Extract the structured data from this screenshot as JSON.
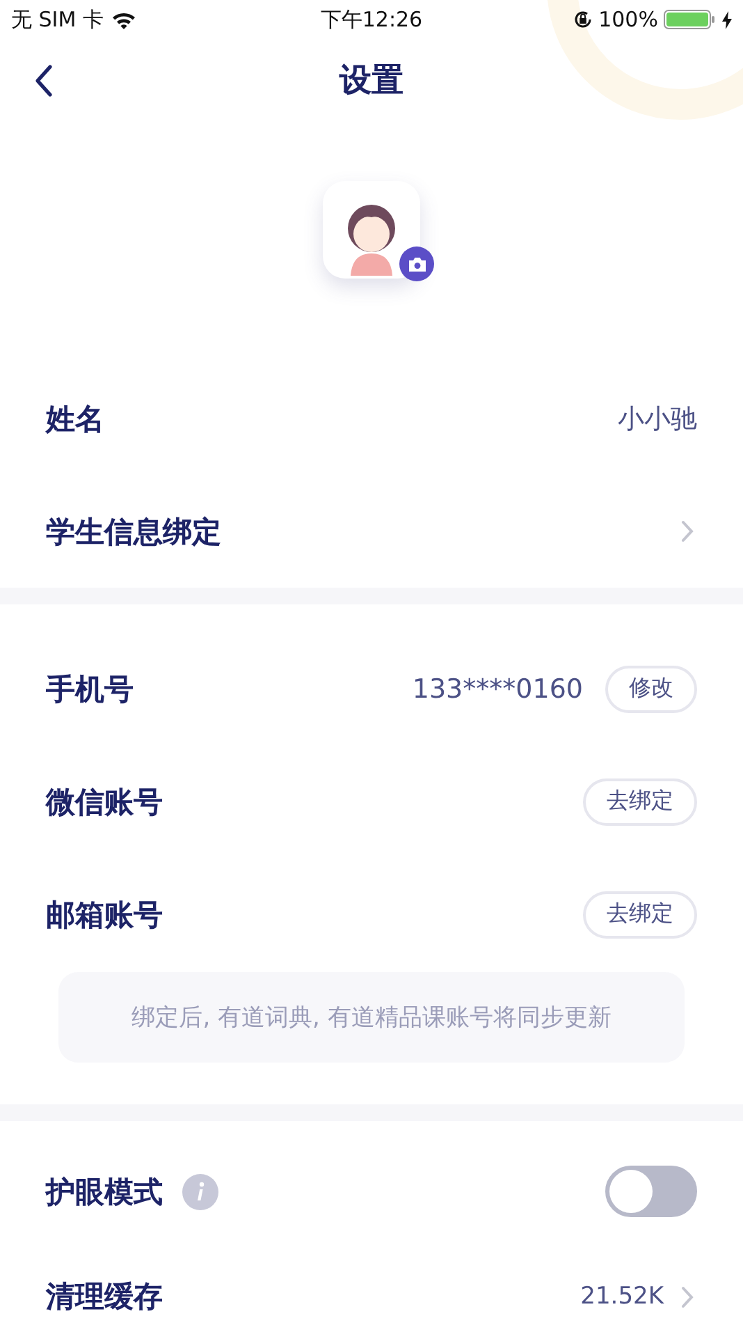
{
  "status_bar": {
    "carrier": "无 SIM 卡",
    "time": "下午12:26",
    "battery": "100%"
  },
  "nav": {
    "title": "设置"
  },
  "sections": [
    {
      "items": [
        {
          "kind": "value",
          "label": "姓名",
          "value": "小小驰"
        },
        {
          "kind": "link",
          "label": "学生信息绑定"
        }
      ]
    },
    {
      "items": [
        {
          "kind": "action",
          "label": "手机号",
          "value": "133****0160",
          "button": "修改"
        },
        {
          "kind": "action",
          "label": "微信账号",
          "button": "去绑定"
        },
        {
          "kind": "action",
          "label": "邮箱账号",
          "button": "去绑定"
        }
      ],
      "note": "绑定后, 有道词典, 有道精品课账号将同步更新"
    },
    {
      "items": [
        {
          "kind": "toggle",
          "label": "护眼模式",
          "info": true,
          "on": false
        },
        {
          "kind": "link",
          "label": "清理缓存",
          "value": "21.52K"
        }
      ]
    }
  ]
}
